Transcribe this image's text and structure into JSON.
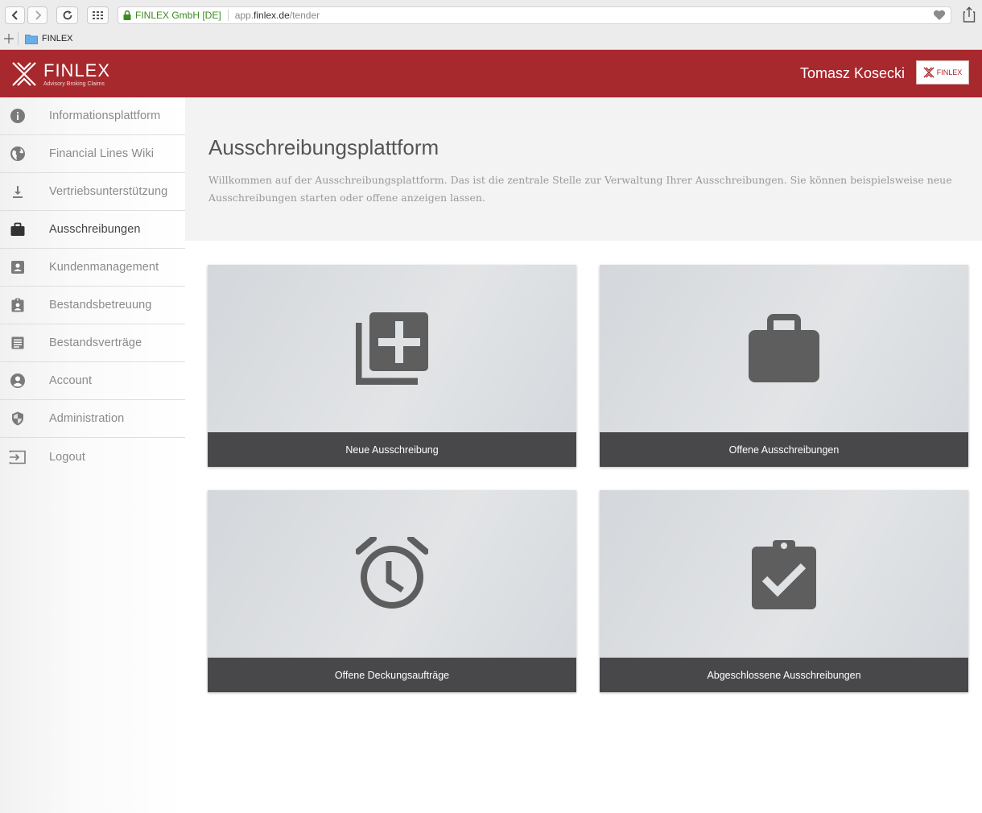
{
  "browser": {
    "org_label": "FINLEX GmbH [DE]",
    "url_prefix": "app.",
    "url_domain": "finlex.de",
    "url_path": "/tender",
    "bookmark_label": "FINLEX"
  },
  "header": {
    "logo_name": "FINLEX",
    "logo_tagline": "Advisory Broking Claims",
    "user_name": "Tomasz Kosecki",
    "badge_label": "FINLEX",
    "brand_color": "#a7282d"
  },
  "sidebar": {
    "items": [
      {
        "label": "Informationsplattform",
        "icon": "info-icon"
      },
      {
        "label": "Financial Lines Wiki",
        "icon": "globe-icon"
      },
      {
        "label": "Vertriebsunterstützung",
        "icon": "download-icon"
      },
      {
        "label": "Ausschreibungen",
        "icon": "briefcase-icon"
      },
      {
        "label": "Kundenmanagement",
        "icon": "contact-card-icon"
      },
      {
        "label": "Bestandsbetreuung",
        "icon": "clipboard-user-icon"
      },
      {
        "label": "Bestandsverträge",
        "icon": "document-icon"
      },
      {
        "label": "Account",
        "icon": "account-icon"
      },
      {
        "label": "Administration",
        "icon": "shield-icon"
      },
      {
        "label": "Logout",
        "icon": "logout-icon"
      }
    ]
  },
  "intro": {
    "title": "Ausschreibungsplattform",
    "text": "Willkommen auf der Ausschreibungsplattform. Das ist die zentrale Stelle zur Verwaltung Ihrer Ausschreibungen. Sie können beispielsweise neue Ausschreibungen starten oder offene anzeigen lassen."
  },
  "tiles": [
    {
      "label": "Neue Ausschreibung",
      "icon": "add-library-icon"
    },
    {
      "label": "Offene Ausschreibungen",
      "icon": "briefcase-icon"
    },
    {
      "label": "Offene Deckungsaufträge",
      "icon": "alarm-clock-icon"
    },
    {
      "label": "Abgeschlossene Ausschreibungen",
      "icon": "clipboard-check-icon"
    }
  ]
}
